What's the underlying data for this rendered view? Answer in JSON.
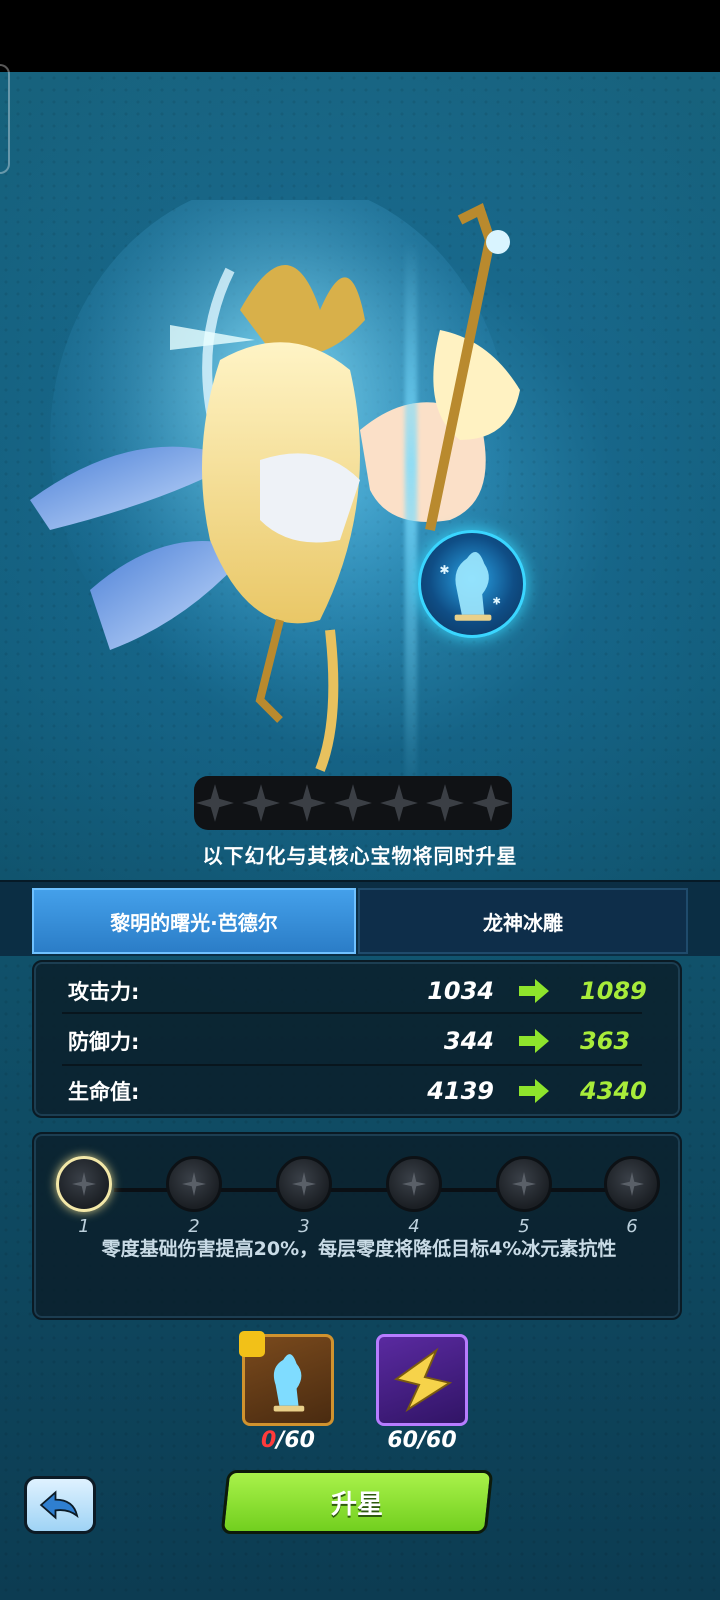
{
  "stars": {
    "count": 7
  },
  "upgrade_note": "以下幻化与其核心宝物将同时升星",
  "tabs": [
    {
      "label": "黎明的曙光·芭德尔",
      "active": true
    },
    {
      "label": "龙神冰雕",
      "active": false
    }
  ],
  "stats": [
    {
      "label": "攻击力:",
      "current": "1034",
      "next": "1089"
    },
    {
      "label": "防御力:",
      "current": "344",
      "next": "363"
    },
    {
      "label": "生命值:",
      "current": "4139",
      "next": "4340"
    }
  ],
  "levels": {
    "items": [
      "1",
      "2",
      "3",
      "4",
      "5",
      "6"
    ],
    "active_index": 0,
    "description": "零度基础伤害提高20%，每层零度将降低目标4%冰元素抗性"
  },
  "materials": [
    {
      "icon": "dragon-ice-statue-icon",
      "owned": "0",
      "required": "/60"
    },
    {
      "icon": "star-fragment-icon",
      "count": "60/60"
    }
  ],
  "buttons": {
    "upgrade_label": "升星",
    "back_icon": "back-arrow-icon"
  },
  "colors": {
    "accent_green": "#a8ec3a",
    "tab_active": "#2b7dc7",
    "shortage_red": "#ff3b3b"
  }
}
